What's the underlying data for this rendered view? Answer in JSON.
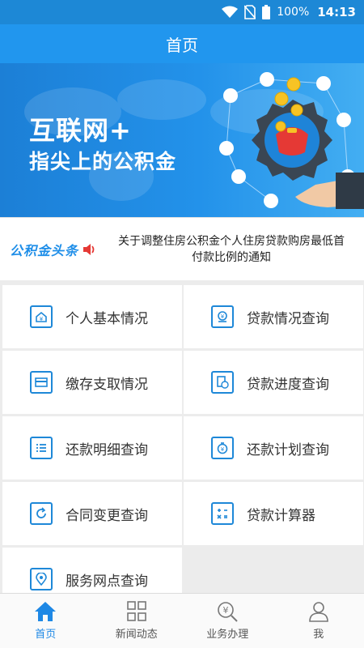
{
  "status_bar": {
    "battery": "100%",
    "time": "14:13"
  },
  "header": {
    "title": "首页"
  },
  "banner": {
    "line1": "互联网+",
    "line2": "指尖上的公积金"
  },
  "news": {
    "logo_text": "公积金头条",
    "headline": "关于调整住房公积金个人住房贷款购房最低首付款比例的通知"
  },
  "tiles": [
    {
      "label": "个人基本情况",
      "icon": "house-doc-icon"
    },
    {
      "label": "贷款情况查询",
      "icon": "loan-query-icon"
    },
    {
      "label": "缴存支取情况",
      "icon": "card-icon"
    },
    {
      "label": "贷款进度查询",
      "icon": "progress-doc-icon"
    },
    {
      "label": "还款明细查询",
      "icon": "list-icon"
    },
    {
      "label": "还款计划查询",
      "icon": "stopwatch-icon"
    },
    {
      "label": "合同变更查询",
      "icon": "refresh-icon"
    },
    {
      "label": "贷款计算器",
      "icon": "calculator-icon"
    },
    {
      "label": "服务网点查询",
      "icon": "location-icon"
    }
  ],
  "bottom_nav": [
    {
      "label": "首页",
      "icon": "home-icon",
      "active": true
    },
    {
      "label": "新闻动态",
      "icon": "grid-icon"
    },
    {
      "label": "业务办理",
      "icon": "yen-search-icon"
    },
    {
      "label": "我",
      "icon": "user-icon"
    }
  ],
  "colors": {
    "primary": "#2196ee",
    "status_bar": "#1d88d6",
    "accent_red": "#e53935",
    "icon_blue": "#1e88d8"
  }
}
